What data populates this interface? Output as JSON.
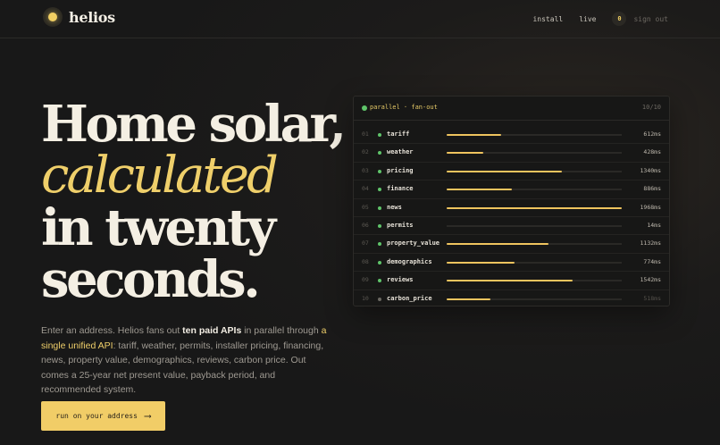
{
  "nav": {
    "brand": "helios",
    "links": [
      "install",
      "live"
    ],
    "badge": "0",
    "signout": "sign out"
  },
  "hero": {
    "line1": "Home solar,",
    "line2": "calculated",
    "line3": "in twenty",
    "line4": "seconds."
  },
  "description": {
    "p1": "Enter an address. Helios fans out ",
    "hl1": "ten paid APIs",
    "p2": " in parallel through ",
    "hl2": "a single unified API",
    "p3": ": tariff, weather, permits, installer pricing, financing, news, property value, demographics, reviews, carbon price. Out comes a 25-year net present value, payback period, and recommended system."
  },
  "cta": {
    "label": "run on your address",
    "arrow": "⟶"
  },
  "panel": {
    "title": "parallel · fan-out",
    "count": "10/10",
    "colors": {
      "done": "#5fc46a",
      "pending": "#6b6862",
      "bar": "#efc45e"
    },
    "rows": [
      {
        "num": "01",
        "name": "tariff",
        "ms": "612ms",
        "progress": 0.31,
        "done": true
      },
      {
        "num": "02",
        "name": "weather",
        "ms": "428ms",
        "progress": 0.21,
        "done": true
      },
      {
        "num": "03",
        "name": "pricing",
        "ms": "1340ms",
        "progress": 0.66,
        "done": true
      },
      {
        "num": "04",
        "name": "finance",
        "ms": "886ms",
        "progress": 0.37,
        "done": true
      },
      {
        "num": "05",
        "name": "news",
        "ms": "1968ms",
        "progress": 1.0,
        "done": true
      },
      {
        "num": "06",
        "name": "permits",
        "ms": "14ms",
        "progress": 0.0,
        "done": true
      },
      {
        "num": "07",
        "name": "property_value",
        "ms": "1132ms",
        "progress": 0.58,
        "done": true
      },
      {
        "num": "08",
        "name": "demographics",
        "ms": "774ms",
        "progress": 0.39,
        "done": true
      },
      {
        "num": "09",
        "name": "reviews",
        "ms": "1542ms",
        "progress": 0.72,
        "done": true
      },
      {
        "num": "10",
        "name": "carbon_price",
        "ms": "518ms",
        "progress": 0.25,
        "done": false
      }
    ]
  }
}
